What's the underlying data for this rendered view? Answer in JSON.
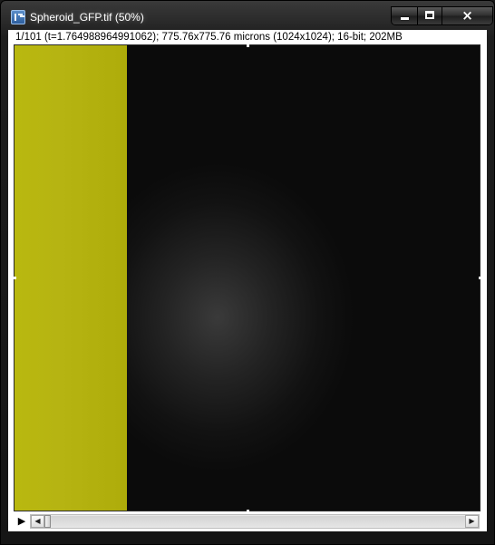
{
  "window": {
    "title": "Spheroid_GFP.tif (50%)",
    "icon": "imagej-icon",
    "controls": {
      "minimize": "minimize-icon",
      "maximize": "maximize-icon",
      "close": "×"
    }
  },
  "info_bar": {
    "text": "1/101 (t=1.764988964991062); 775.76x775.76 microns (1024x1024); 16-bit; 202MB"
  },
  "image": {
    "colors": {
      "yellow_band": "#b6b412",
      "background": "#0b0b0b",
      "glow": "#3a3a3a"
    }
  },
  "stack_controls": {
    "play": "▶",
    "scroll_left": "◀",
    "scroll_right": "▶",
    "slice_position": 1,
    "slice_count": 101
  }
}
